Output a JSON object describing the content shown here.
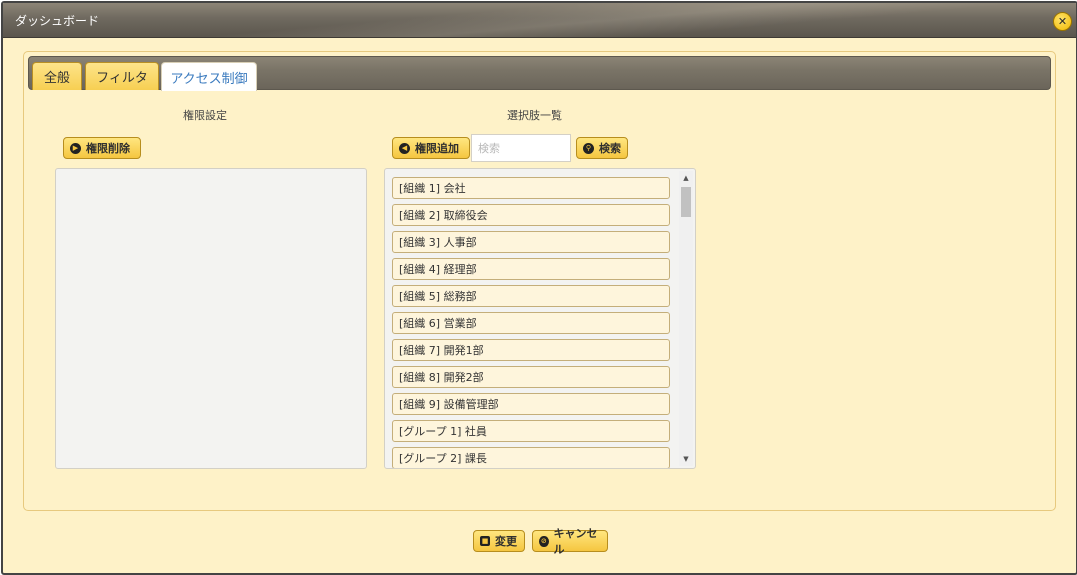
{
  "window": {
    "title": "ダッシュボード",
    "close_icon": "close-icon"
  },
  "tabs": [
    {
      "label": "全般"
    },
    {
      "label": "フィルタ"
    },
    {
      "label": "アクセス制御",
      "active": true
    }
  ],
  "permissions": {
    "heading": "権限設定",
    "remove_button": "権限削除",
    "remove_icon": "remove-arrow-icon"
  },
  "choices": {
    "heading": "選択肢一覧",
    "add_button": "権限追加",
    "add_icon": "add-arrow-icon",
    "search_placeholder": "検索",
    "search_value": "",
    "search_button": "検索",
    "search_icon": "magnifier-icon",
    "items": [
      "[組織 1] 会社",
      "[組織 2] 取締役会",
      "[組織 3] 人事部",
      "[組織 4] 経理部",
      "[組織 5] 総務部",
      "[組織 6] 営業部",
      "[組織 7] 開発1部",
      "[組織 8] 開発2部",
      "[組織 9] 設備管理部",
      "[グループ 1] 社員",
      "[グループ 2] 課長"
    ]
  },
  "footer": {
    "save_button": "変更",
    "save_icon": "save-icon",
    "cancel_button": "キャンセル",
    "cancel_icon": "cancel-icon"
  },
  "colors": {
    "dialog_bg": "#fef2c8",
    "titlebar": "#6f695f",
    "button": "#f5c640",
    "active_tab_text": "#3b7bbf"
  }
}
